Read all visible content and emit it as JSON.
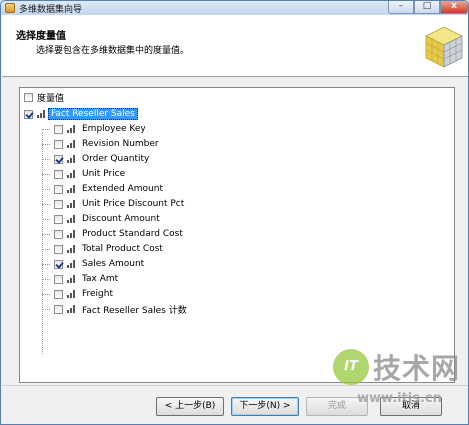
{
  "window": {
    "title": "多维数据集向导",
    "controls": {
      "minimize": "–",
      "maximize": "□",
      "close": "x"
    }
  },
  "header": {
    "title": "选择度量值",
    "subtitle": "选择要包含在多维数据集中的度量值。",
    "icon": "cube-icon"
  },
  "tree": {
    "root": {
      "label": "度量值",
      "checked": false
    },
    "group": {
      "label": "Fact Reseller Sales",
      "checked": true
    },
    "items": [
      {
        "label": "Employee Key",
        "checked": false
      },
      {
        "label": "Revision Number",
        "checked": false
      },
      {
        "label": "Order Quantity",
        "checked": true
      },
      {
        "label": "Unit Price",
        "checked": false
      },
      {
        "label": "Extended Amount",
        "checked": false
      },
      {
        "label": "Unit Price Discount Pct",
        "checked": false
      },
      {
        "label": "Discount Amount",
        "checked": false
      },
      {
        "label": "Product Standard Cost",
        "checked": false
      },
      {
        "label": "Total Product Cost",
        "checked": false
      },
      {
        "label": "Sales Amount",
        "checked": true
      },
      {
        "label": "Tax Amt",
        "checked": false
      },
      {
        "label": "Freight",
        "checked": false
      },
      {
        "label": "Fact Reseller Sales 计数",
        "checked": false
      }
    ]
  },
  "footer": {
    "back": "< 上一步(B)",
    "next": "下一步(N) >",
    "finish": "完成",
    "cancel": "取消"
  },
  "watermark": {
    "logo": "IT",
    "text": "技术网",
    "url": "www.itjs.cn"
  }
}
